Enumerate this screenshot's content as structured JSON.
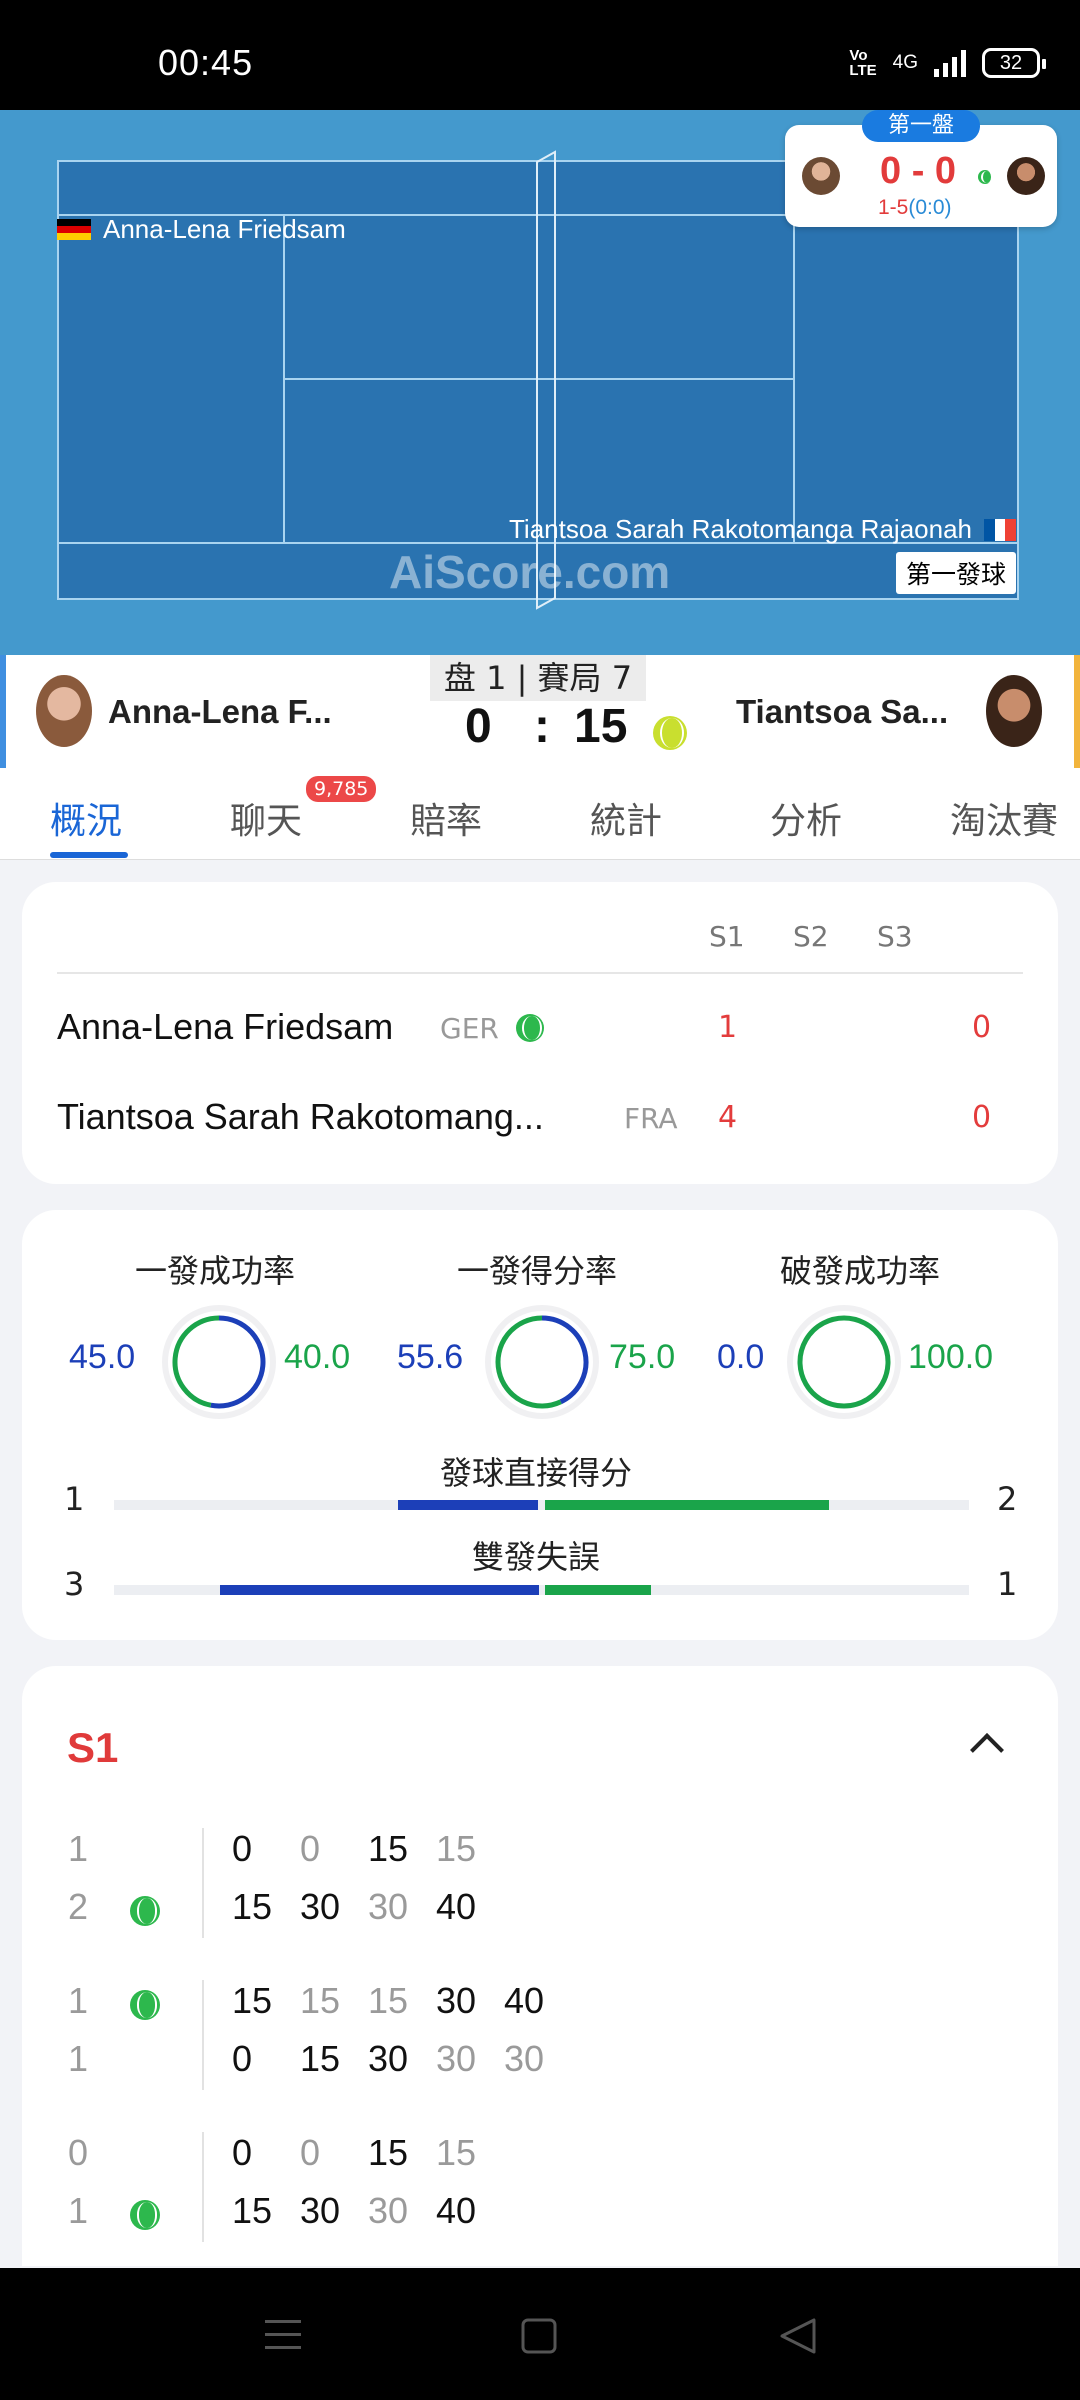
{
  "status_bar": {
    "time": "00:45",
    "network": "4G",
    "battery": "32"
  },
  "court": {
    "player1": "Anna-Lena Friedsam",
    "player2": "Tiantsoa Sarah Rakotomanga Rajaonah",
    "watermark": "AiScore.com",
    "serve_label": "第一發球",
    "mini_set_label": "第一盤",
    "mini_score": "0 - 0",
    "mini_sub_main": "1-5",
    "mini_sub_paren": "(0:0)"
  },
  "score_header": {
    "player1_short": "Anna-Lena F...",
    "player2_short": "Tiantsoa Sa...",
    "game_label": "盘 1 | 賽局 7",
    "score_left": "0",
    "score_sep": ":",
    "score_right": "15"
  },
  "tabs": [
    "概況",
    "聊天",
    "賠率",
    "統計",
    "分析",
    "淘汰賽"
  ],
  "chat_badge": "9,785",
  "set_table": {
    "headers": [
      "S1",
      "S2",
      "S3"
    ],
    "rows": [
      {
        "name": "Anna-Lena Friedsam",
        "country": "GER",
        "s1": "1",
        "game": "0"
      },
      {
        "name": "Tiantsoa Sarah Rakotomang...",
        "country": "FRA",
        "s1": "4",
        "game": "0"
      }
    ]
  },
  "stats": {
    "rings": [
      {
        "title": "一發成功率",
        "left": "45.0",
        "right": "40.0",
        "left_frac": 0.53,
        "right_frac": 0.47
      },
      {
        "title": "一發得分率",
        "left": "55.6",
        "right": "75.0",
        "left_frac": 0.43,
        "right_frac": 0.57
      },
      {
        "title": "破發成功率",
        "left": "0.0",
        "right": "100.0",
        "left_frac": 0.0,
        "right_frac": 1.0
      }
    ],
    "bars": [
      {
        "title": "發球直接得分",
        "left": "1",
        "right": "2",
        "left_frac": 0.33,
        "right_frac": 0.67
      },
      {
        "title": "雙發失誤",
        "left": "3",
        "right": "1",
        "left_frac": 0.75,
        "right_frac": 0.25
      }
    ],
    "colors": {
      "left": "#1c3fb8",
      "right": "#1aa44a"
    }
  },
  "s1": {
    "title": "S1",
    "games": [
      {
        "top": {
          "n": "1",
          "serve": false,
          "pts": [
            "0",
            "0",
            "15",
            "15"
          ]
        },
        "bottom": {
          "n": "2",
          "serve": true,
          "pts": [
            "15",
            "30",
            "30",
            "40"
          ]
        }
      },
      {
        "top": {
          "n": "1",
          "serve": true,
          "pts": [
            "15",
            "15",
            "15",
            "30",
            "40"
          ]
        },
        "bottom": {
          "n": "1",
          "serve": false,
          "pts": [
            "0",
            "15",
            "30",
            "30",
            "30"
          ]
        }
      },
      {
        "top": {
          "n": "0",
          "serve": false,
          "pts": [
            "0",
            "0",
            "15",
            "15"
          ]
        },
        "bottom": {
          "n": "1",
          "serve": true,
          "pts": [
            "15",
            "30",
            "30",
            "40"
          ]
        }
      }
    ]
  }
}
